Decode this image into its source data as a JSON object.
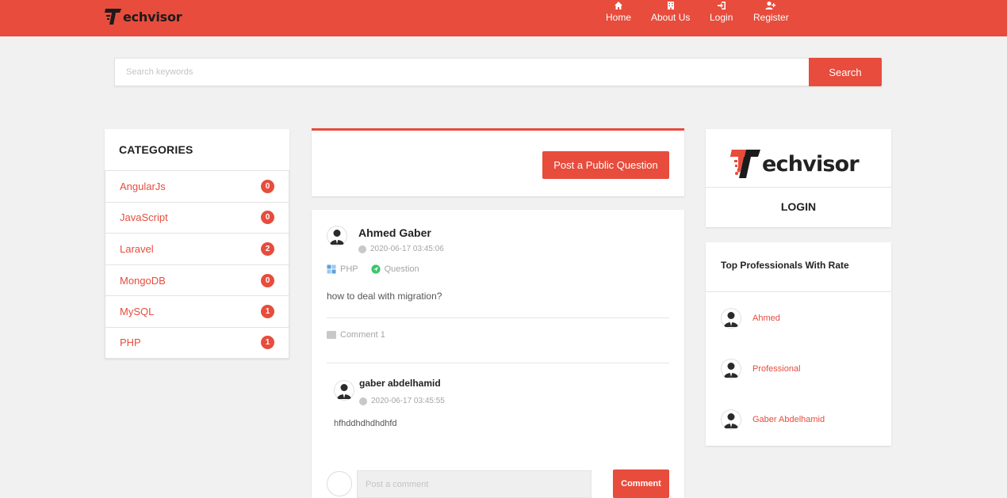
{
  "brand": {
    "name": "echvisor",
    "accent": "#e74c3c"
  },
  "nav": [
    {
      "label": "Home",
      "icon": "home-icon"
    },
    {
      "label": "About Us",
      "icon": "building-icon"
    },
    {
      "label": "Login",
      "icon": "sign-in-icon"
    },
    {
      "label": "Register",
      "icon": "user-plus-icon"
    }
  ],
  "search": {
    "placeholder": "Search keywords",
    "button": "Search"
  },
  "categories": {
    "title": "CATEGORIES",
    "items": [
      {
        "label": "AngularJs",
        "count": "0"
      },
      {
        "label": "JavaScript",
        "count": "0"
      },
      {
        "label": "Laravel",
        "count": "2"
      },
      {
        "label": "MongoDB",
        "count": "0"
      },
      {
        "label": "MySQL",
        "count": "1"
      },
      {
        "label": "PHP",
        "count": "1"
      }
    ]
  },
  "ask": {
    "button": "Post a Public Question"
  },
  "post": {
    "author": "Ahmed Gaber",
    "date": "2020-06-17 03:45:06",
    "category": "PHP",
    "type": "Question",
    "body": "how to deal with migration?",
    "comment_count": "Comment 1",
    "comments": [
      {
        "author": "gaber abdelhamid",
        "date": "2020-06-17 03:45:55",
        "body": "hfhddhdhdhdhfd"
      }
    ],
    "comment_placeholder": "Post a comment",
    "comment_button": "Comment"
  },
  "login_card": {
    "logo_text": "echvisor",
    "link": "LOGIN"
  },
  "professionals": {
    "title": "Top Professionals With Rate",
    "items": [
      {
        "name": "Ahmed"
      },
      {
        "name": "Professional"
      },
      {
        "name": "Gaber Abdelhamid"
      }
    ]
  }
}
